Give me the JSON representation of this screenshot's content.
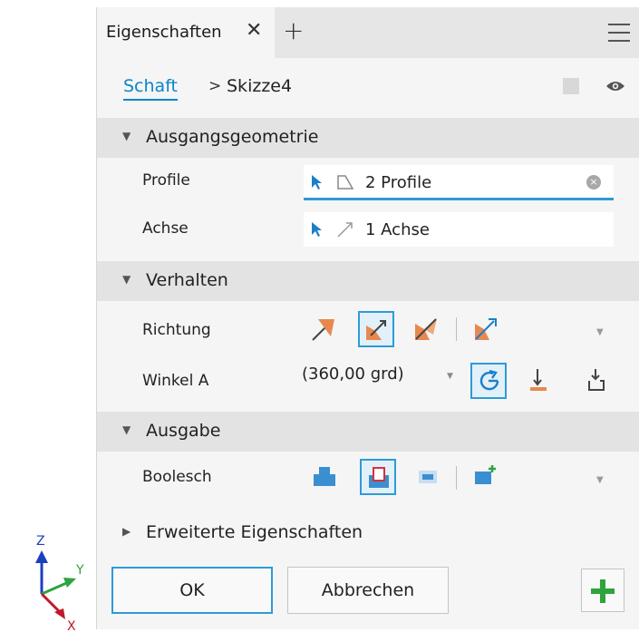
{
  "tab": {
    "label": "Eigenschaften",
    "close_glyph": "✕",
    "add_glyph": "+"
  },
  "breadcrumb": {
    "parent": "Schaft",
    "separator": ">",
    "current": "Skizze4"
  },
  "sections": {
    "ausgangsgeometrie": {
      "title": "Ausgangsgeometrie",
      "expanded": true
    },
    "verhalten": {
      "title": "Verhalten",
      "expanded": true
    },
    "ausgabe": {
      "title": "Ausgabe",
      "expanded": true
    },
    "erweitert": {
      "title": "Erweiterte Eigenschaften",
      "expanded": false
    }
  },
  "arrows": {
    "expanded": "▼",
    "collapsed": "▶"
  },
  "fields": {
    "profile": {
      "label": "Profile",
      "value": "2 Profile",
      "icon": "profile-region-icon"
    },
    "achse": {
      "label": "Achse",
      "value": "1 Achse",
      "icon": "axis-line-icon"
    }
  },
  "behavior": {
    "richtung_label": "Richtung",
    "richtung_selected": "direction-2",
    "winkel_label": "Winkel A",
    "winkel_value": "(360,00 grd)",
    "winkel_mode_selected": "full"
  },
  "output": {
    "boolesch_label": "Boolesch",
    "selected": "cut"
  },
  "buttons": {
    "ok": "OK",
    "cancel": "Abbrechen",
    "apply_icon": "plus-icon"
  },
  "triad": {
    "x": "X",
    "y": "Y",
    "z": "Z"
  },
  "colors": {
    "accent": "#2e9bd6",
    "link": "#0a86c9",
    "orange": "#e8884f",
    "green": "#2fa33e",
    "triad_x": "#c0182a",
    "triad_y": "#2fa33e",
    "triad_z": "#1a3fbf"
  }
}
